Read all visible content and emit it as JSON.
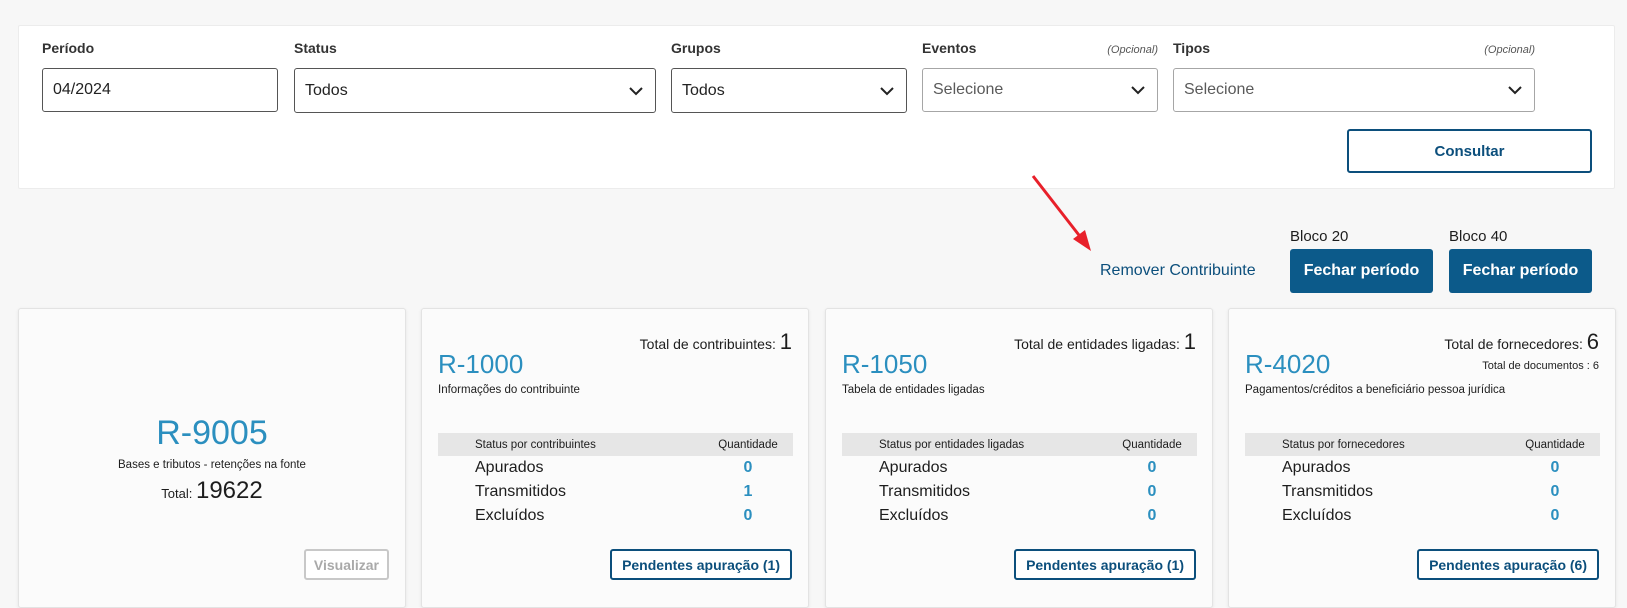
{
  "filters": {
    "period": {
      "label": "Período",
      "value": "04/2024"
    },
    "status": {
      "label": "Status",
      "value": "Todos"
    },
    "groups": {
      "label": "Grupos",
      "value": "Todos"
    },
    "events": {
      "label": "Eventos",
      "optional": "(Opcional)",
      "placeholder": "Selecione"
    },
    "types": {
      "label": "Tipos",
      "optional": "(Opcional)",
      "placeholder": "Selecione"
    },
    "consult_label": "Consultar"
  },
  "actions": {
    "remove_label": "Remover Contribuinte",
    "bloco20": {
      "label": "Bloco 20",
      "button": "Fechar período"
    },
    "bloco40": {
      "label": "Bloco 40",
      "button": "Fechar período"
    }
  },
  "cards": {
    "r9005": {
      "code": "R-9005",
      "desc": "Bases e tributos - retenções na fonte",
      "total_label": "Total:",
      "total": "19622",
      "button": "Visualizar"
    },
    "r1000": {
      "code": "R-1000",
      "desc": "Informações do contribuinte",
      "total_label": "Total de contribuintes:",
      "total": "1",
      "head_status": "Status por contribuintes",
      "head_qty": "Quantidade",
      "rows": [
        {
          "label": "Apurados",
          "value": "0"
        },
        {
          "label": "Transmitidos",
          "value": "1"
        },
        {
          "label": "Excluídos",
          "value": "0"
        }
      ],
      "button": "Pendentes apuração (1)"
    },
    "r1050": {
      "code": "R-1050",
      "desc": "Tabela de entidades ligadas",
      "total_label": "Total de entidades ligadas:",
      "total": "1",
      "head_status": "Status por entidades ligadas",
      "head_qty": "Quantidade",
      "rows": [
        {
          "label": "Apurados",
          "value": "0"
        },
        {
          "label": "Transmitidos",
          "value": "0"
        },
        {
          "label": "Excluídos",
          "value": "0"
        }
      ],
      "button": "Pendentes apuração (1)"
    },
    "r4020": {
      "code": "R-4020",
      "desc": "Pagamentos/créditos a beneficiário pessoa jurídica",
      "total_label": "Total de fornecedores:",
      "total": "6",
      "sub_total": "Total de documentos : 6",
      "head_status": "Status por fornecedores",
      "head_qty": "Quantidade",
      "rows": [
        {
          "label": "Apurados",
          "value": "0"
        },
        {
          "label": "Transmitidos",
          "value": "0"
        },
        {
          "label": "Excluídos",
          "value": "0"
        }
      ],
      "button": "Pendentes apuração (6)"
    }
  },
  "colors": {
    "primary": "#0c5a8a",
    "accent": "#2b8fbf",
    "annotation": "#e8202a"
  }
}
